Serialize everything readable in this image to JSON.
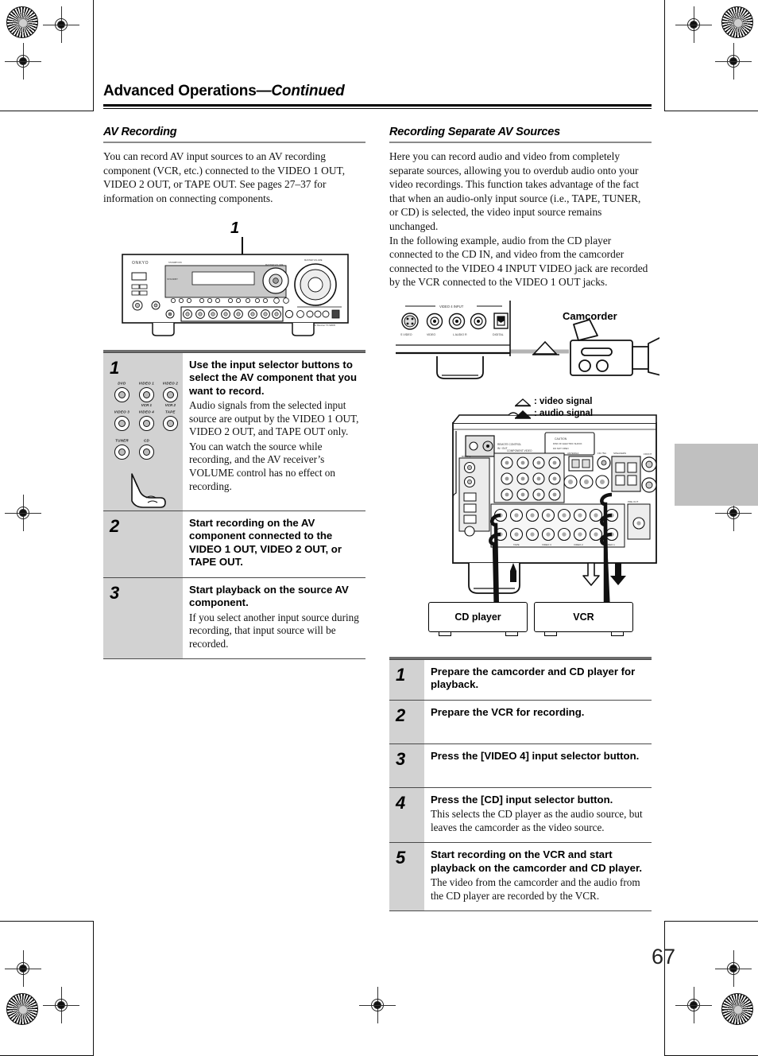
{
  "page": {
    "running_header_main": "Advanced Operations",
    "running_header_cont": "—Continued",
    "page_number": "67"
  },
  "left_column": {
    "section_title": "AV Recording",
    "intro": "You can record AV input sources to an AV recording component (VCR, etc.) connected to the VIDEO 1 OUT, VIDEO 2 OUT, or TAPE OUT. See pages 27–37 for information on connecting components.",
    "callout_number": "1",
    "front_panel": {
      "brand": "ONKYO",
      "display_label": "STANDBY",
      "model_text": "AV Receiver   TX-SR605"
    },
    "button_grid": {
      "rows": [
        [
          {
            "top": "DVD",
            "bottom": ""
          },
          {
            "top": "VIDEO 1",
            "bottom": "VCR 1"
          },
          {
            "top": "VIDEO 2",
            "bottom": "VCR 2"
          }
        ],
        [
          {
            "top": "VIDEO 3",
            "bottom": ""
          },
          {
            "top": "VIDEO 4",
            "bottom": ""
          },
          {
            "top": "TAPE",
            "bottom": ""
          }
        ],
        [
          {
            "top": "TUNER",
            "bottom": ""
          },
          {
            "top": "CD",
            "bottom": ""
          }
        ]
      ]
    },
    "steps": [
      {
        "number": "1",
        "bold": "Use the input selector buttons to select the AV component that you want to record.",
        "plain": [
          "Audio signals from the selected input source are output by the VIDEO 1 OUT, VIDEO 2 OUT, and TAPE OUT only.",
          "You can watch the source while recording, and the AV receiver’s VOLUME control has no effect on recording."
        ]
      },
      {
        "number": "2",
        "bold": "Start recording on the AV component connected to the VIDEO 1 OUT, VIDEO 2 OUT, or TAPE OUT.",
        "plain": []
      },
      {
        "number": "3",
        "bold": "Start playback on the source AV component.",
        "plain": [
          "If you select another input source during recording, that input source will be recorded."
        ]
      }
    ]
  },
  "right_column": {
    "section_title": "Recording Separate AV Sources",
    "paragraphs": [
      "Here you can record audio and video from completely separate sources, allowing you to overdub audio onto your video recordings. This function takes advantage of the fact that when an audio-only input source (i.e., TAPE, TUNER, or CD) is selected, the video input source remains unchanged.",
      "In the following example, audio from the CD player connected to the CD IN, and video from the camcorder connected to the VIDEO 4 INPUT VIDEO jack are recorded by the VCR connected to the VIDEO 1 OUT jacks."
    ],
    "diagram": {
      "front_input_header": "VIDEO 4 INPUT",
      "front_input_jacks": [
        "S VIDEO",
        "VIDEO",
        "L   AUDIO   R",
        "DIGITAL"
      ],
      "camcorder_label": "Camcorder",
      "legend": [
        {
          "icon": "video-signal-arrow",
          "text": ": video signal"
        },
        {
          "icon": "audio-signal-arrow",
          "text": ": audio signal"
        }
      ],
      "device_boxes": [
        {
          "label": "CD player"
        },
        {
          "label": "VCR"
        }
      ],
      "rear_panel_labels": [
        "COMPONENT VIDEO",
        "ANTENNA",
        "FM 75Ω",
        "PRE OUT",
        "SPEAKERS",
        "SUB WOOFER",
        "MONITOR OUT",
        "IN",
        "OUT",
        "CD",
        "TAPE",
        "VIDEO 1",
        "VIDEO 2",
        "VIDEO 3",
        "DVD"
      ]
    },
    "steps": [
      {
        "number": "1",
        "bold": "Prepare the camcorder and CD player for playback.",
        "plain": []
      },
      {
        "number": "2",
        "bold": "Prepare the VCR for recording.",
        "plain": []
      },
      {
        "number": "3",
        "bold": "Press the [VIDEO 4] input selector button.",
        "plain": []
      },
      {
        "number": "4",
        "bold": "Press the [CD] input selector button.",
        "plain": [
          "This selects the CD player as the audio source, but leaves the camcorder as the video source."
        ]
      },
      {
        "number": "5",
        "bold": "Start recording on the VCR and start playback on the camcorder and CD player.",
        "plain": [
          "The video from the camcorder and the audio from the CD player are recorded by the VCR."
        ]
      }
    ]
  },
  "colors": {
    "step_number_bg": "#d2d2d2",
    "rule": "#4a4a4a",
    "section_rule": "#8a8a8a",
    "thumb_tab": "#c0c0c0",
    "cable": "#111111"
  }
}
